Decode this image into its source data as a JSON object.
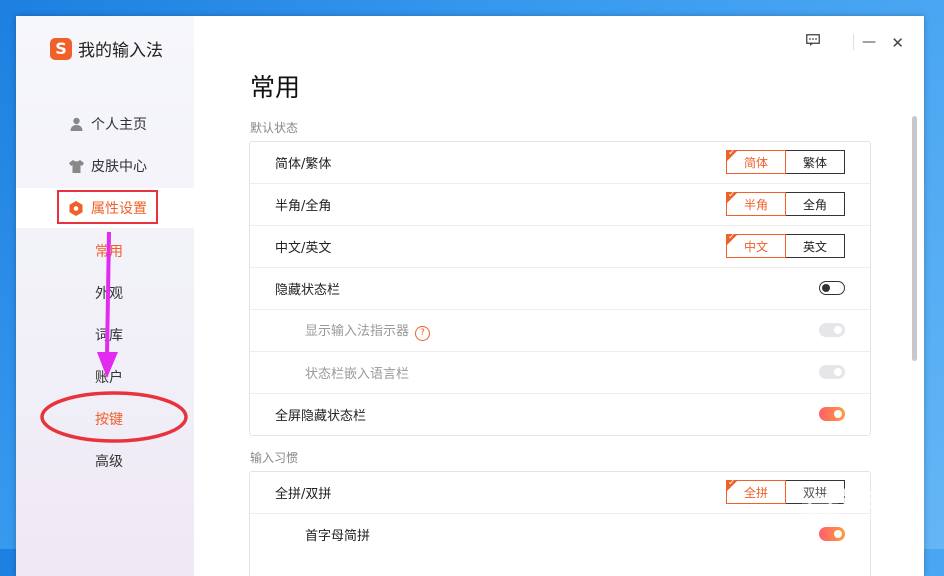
{
  "app": {
    "name": "我的输入法",
    "logo_letter": "S",
    "brand_color": "#f0602a"
  },
  "titlebar": {
    "feedback_icon": "message-icon",
    "minimize": "—",
    "close": "✕"
  },
  "sidebar": {
    "items": [
      {
        "label": "个人主页",
        "icon": "user-icon"
      },
      {
        "label": "皮肤中心",
        "icon": "shirt-icon"
      },
      {
        "label": "属性设置",
        "icon": "hexagon-settings-icon",
        "active": true
      }
    ],
    "subitems": [
      {
        "label": "常用",
        "active": true
      },
      {
        "label": "外观"
      },
      {
        "label": "词库"
      },
      {
        "label": "账户"
      },
      {
        "label": "按键",
        "highlighted": true
      },
      {
        "label": "高级"
      }
    ]
  },
  "main": {
    "title": "常用",
    "section_default": "默认状态",
    "section_input": "输入习惯",
    "rows_default": [
      {
        "label": "简体/繁体",
        "options": [
          "简体",
          "繁体"
        ],
        "selected": 0
      },
      {
        "label": "半角/全角",
        "options": [
          "半角",
          "全角"
        ],
        "selected": 0
      },
      {
        "label": "中文/英文",
        "options": [
          "中文",
          "英文"
        ],
        "selected": 0
      },
      {
        "label": "隐藏状态栏",
        "toggle": "off"
      },
      {
        "label": "显示输入法指示器",
        "toggle": "disabled",
        "help": "?"
      },
      {
        "label": "状态栏嵌入语言栏",
        "toggle": "disabled"
      },
      {
        "label": "全屏隐藏状态栏",
        "toggle": "on"
      }
    ],
    "rows_input": [
      {
        "label": "全拼/双拼",
        "options": [
          "全拼",
          "双拼"
        ],
        "selected": 0
      },
      {
        "label": "首字母简拼",
        "toggle": "on"
      }
    ]
  },
  "annotation": {
    "arrow_color": "#e22bf0",
    "circle_color": "#e8333d",
    "box_color": "#e8333d"
  },
  "watermark": {
    "name": "路由器",
    "url": "luyouqi.com"
  }
}
